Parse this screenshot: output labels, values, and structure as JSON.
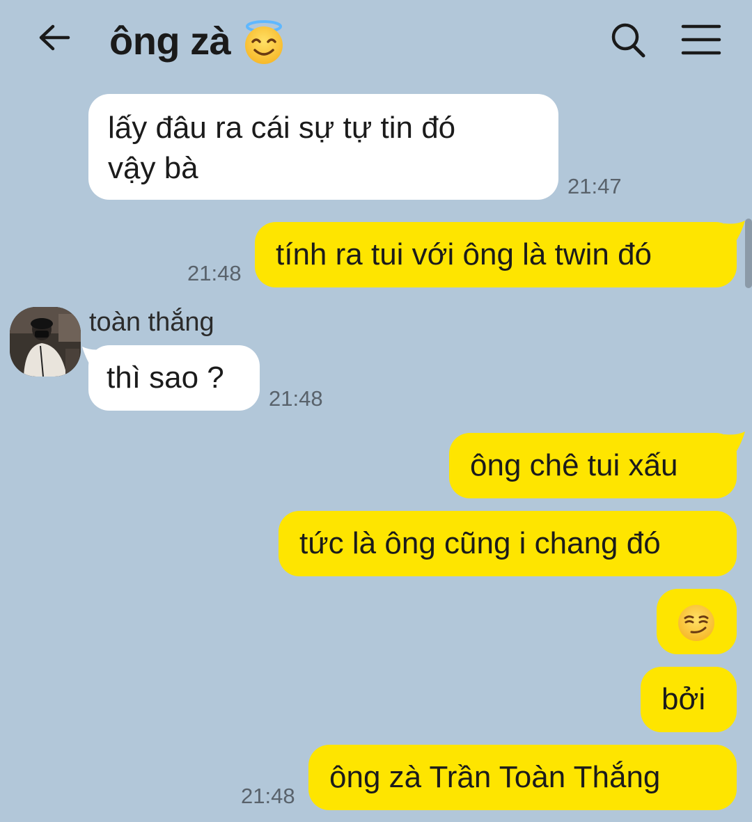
{
  "header": {
    "title": "ông zà",
    "title_emoji": "smiling-face-with-halo",
    "back_icon": "arrow-left-icon",
    "search_icon": "search-icon",
    "menu_icon": "hamburger-menu-icon"
  },
  "contact": {
    "name": "toàn thắng"
  },
  "messages": [
    {
      "direction": "in",
      "text_line1": "lấy đâu ra cái sự tự tin đó",
      "text_line2": "vậy bà",
      "time": "21:47"
    },
    {
      "direction": "out",
      "text": "tính ra tui với ông là twin đó",
      "time": "21:48"
    },
    {
      "direction": "in",
      "text": "thì sao ?",
      "time": "21:48"
    },
    {
      "direction": "out",
      "text": "ông chê tui xấu"
    },
    {
      "direction": "out",
      "text": "tức là ông cũng i chang đó"
    },
    {
      "direction": "out",
      "emoji": "smirking-face"
    },
    {
      "direction": "out",
      "text": "bởi"
    },
    {
      "direction": "out",
      "text": "ông zà Trần Toàn Thắng",
      "time": "21:48"
    }
  ],
  "colors": {
    "background": "#b2c7d9",
    "outgoing_bubble": "#fee500",
    "incoming_bubble": "#ffffff",
    "timestamp": "#59626b"
  }
}
